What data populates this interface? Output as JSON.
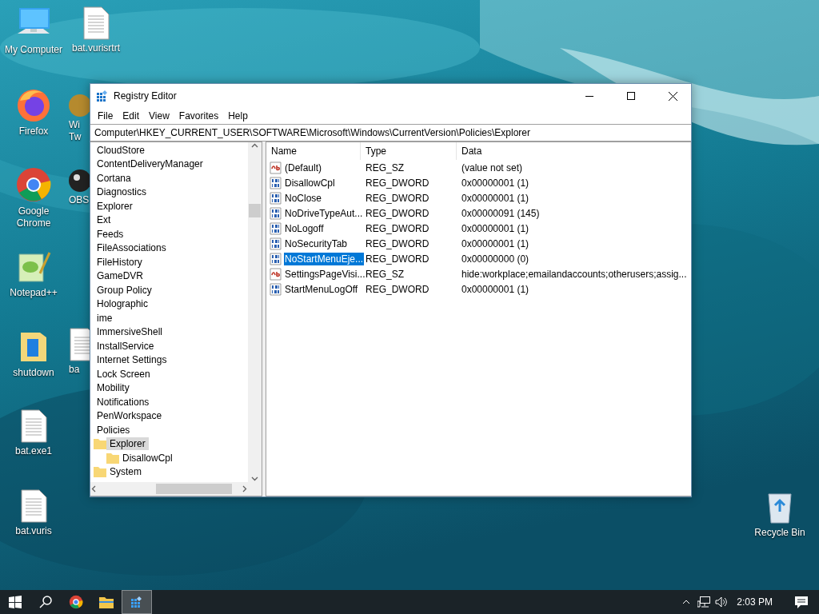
{
  "desktop": {
    "icons": [
      {
        "label": "My Computer",
        "kind": "computer"
      },
      {
        "label": "bat.vurisrtrt",
        "kind": "document"
      },
      {
        "label": "Firefox",
        "kind": "firefox"
      },
      {
        "label": "Google Chrome",
        "kind": "chrome"
      },
      {
        "label": "Notepad++",
        "kind": "notepad"
      },
      {
        "label": "shutdown",
        "kind": "folder"
      },
      {
        "label": "bat.exe1",
        "kind": "document"
      },
      {
        "label": "bat.vuris",
        "kind": "document"
      },
      {
        "label": "Recycle Bin",
        "kind": "recycle"
      }
    ],
    "partial_icons": [
      {
        "label": "Wi Tw",
        "kind": "app"
      },
      {
        "label": "OBS",
        "kind": "obs"
      },
      {
        "label": "ba",
        "kind": "document"
      }
    ]
  },
  "window": {
    "title": "Registry Editor",
    "menu": [
      "File",
      "Edit",
      "View",
      "Favorites",
      "Help"
    ],
    "address": "Computer\\HKEY_CURRENT_USER\\SOFTWARE\\Microsoft\\Windows\\CurrentVersion\\Policies\\Explorer",
    "tree": [
      {
        "label": "CloudStore",
        "selected": false
      },
      {
        "label": "ContentDeliveryManager",
        "selected": false
      },
      {
        "label": "Cortana",
        "selected": false
      },
      {
        "label": "Diagnostics",
        "selected": false
      },
      {
        "label": "Explorer",
        "selected": false
      },
      {
        "label": "Ext",
        "selected": false
      },
      {
        "label": "Feeds",
        "selected": false
      },
      {
        "label": "FileAssociations",
        "selected": false
      },
      {
        "label": "FileHistory",
        "selected": false
      },
      {
        "label": "GameDVR",
        "selected": false
      },
      {
        "label": "Group Policy",
        "selected": false
      },
      {
        "label": "Holographic",
        "selected": false
      },
      {
        "label": "ime",
        "selected": false
      },
      {
        "label": "ImmersiveShell",
        "selected": false
      },
      {
        "label": "InstallService",
        "selected": false
      },
      {
        "label": "Internet Settings",
        "selected": false
      },
      {
        "label": "Lock Screen",
        "selected": false
      },
      {
        "label": "Mobility",
        "selected": false
      },
      {
        "label": "Notifications",
        "selected": false
      },
      {
        "label": "PenWorkspace",
        "selected": false
      },
      {
        "label": "Policies",
        "selected": false,
        "children": [
          {
            "label": "Explorer",
            "selected": true,
            "children": [
              {
                "label": "DisallowCpl",
                "selected": false
              }
            ]
          },
          {
            "label": "System",
            "selected": false
          }
        ]
      }
    ],
    "columns": [
      "Name",
      "Type",
      "Data"
    ],
    "values": [
      {
        "kind": "sz",
        "name": "(Default)",
        "type": "REG_SZ",
        "data": "(value not set)",
        "selected": false
      },
      {
        "kind": "dword",
        "name": "DisallowCpl",
        "type": "REG_DWORD",
        "data": "0x00000001 (1)",
        "selected": false
      },
      {
        "kind": "dword",
        "name": "NoClose",
        "type": "REG_DWORD",
        "data": "0x00000001 (1)",
        "selected": false
      },
      {
        "kind": "dword",
        "name": "NoDriveTypeAut...",
        "type": "REG_DWORD",
        "data": "0x00000091 (145)",
        "selected": false
      },
      {
        "kind": "dword",
        "name": "NoLogoff",
        "type": "REG_DWORD",
        "data": "0x00000001 (1)",
        "selected": false
      },
      {
        "kind": "dword",
        "name": "NoSecurityTab",
        "type": "REG_DWORD",
        "data": "0x00000001 (1)",
        "selected": false
      },
      {
        "kind": "dword",
        "name": "NoStartMenuEje...",
        "type": "REG_DWORD",
        "data": "0x00000000 (0)",
        "selected": true
      },
      {
        "kind": "sz",
        "name": "SettingsPageVisi...",
        "type": "REG_SZ",
        "data": "hide:workplace;emailandaccounts;otherusers;assig...",
        "selected": false
      },
      {
        "kind": "dword",
        "name": "StartMenuLogOff",
        "type": "REG_DWORD",
        "data": "0x00000001 (1)",
        "selected": false
      }
    ]
  },
  "taskbar": {
    "apps": [
      {
        "kind": "chrome",
        "selected": false
      },
      {
        "kind": "explorer",
        "selected": false
      },
      {
        "kind": "regedit",
        "selected": true
      }
    ],
    "clock": "2:03 PM"
  }
}
